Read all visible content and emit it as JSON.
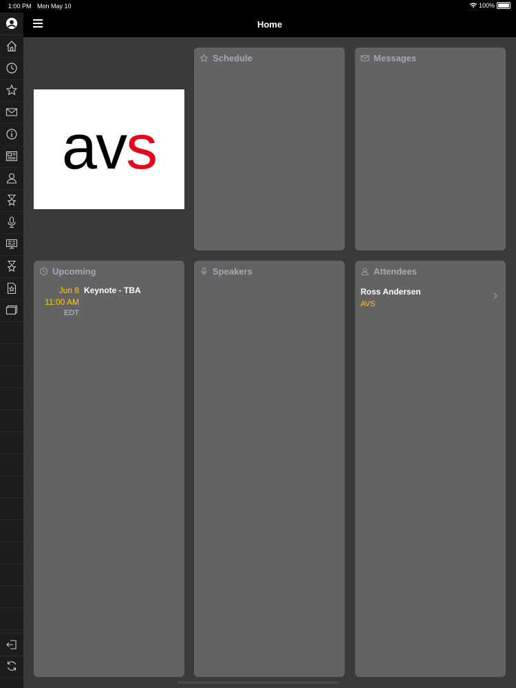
{
  "status_bar": {
    "time": "1:00 PM",
    "date": "Mon May 10",
    "battery": "100%"
  },
  "navbar": {
    "title": "Home",
    "menu_icon": "hamburger-icon"
  },
  "sidebar": {
    "items": [
      {
        "icon": "home-icon"
      },
      {
        "icon": "clock-icon"
      },
      {
        "icon": "star-icon"
      },
      {
        "icon": "envelope-icon"
      },
      {
        "icon": "info-icon"
      },
      {
        "icon": "newspaper-icon"
      },
      {
        "icon": "people-icon"
      },
      {
        "icon": "award-star-icon"
      },
      {
        "icon": "microphone-icon"
      },
      {
        "icon": "presentation-icon"
      },
      {
        "icon": "award-star-icon"
      },
      {
        "icon": "document-star-icon"
      },
      {
        "icon": "windows-icon"
      }
    ],
    "bottom": [
      {
        "icon": "logout-icon"
      },
      {
        "icon": "refresh-icon"
      }
    ]
  },
  "logo": {
    "text_dark": "av",
    "text_red": "s"
  },
  "cards": {
    "schedule": {
      "title": "Schedule",
      "icon": "star-icon"
    },
    "messages": {
      "title": "Messages",
      "icon": "envelope-icon"
    },
    "upcoming": {
      "title": "Upcoming",
      "icon": "clock-icon",
      "events": [
        {
          "day": "Jun 8",
          "time": "11:00 AM",
          "tz": "EDT",
          "name": "Keynote - TBA"
        }
      ]
    },
    "speakers": {
      "title": "Speakers",
      "icon": "microphone-icon"
    },
    "attendees": {
      "title": "Attendees",
      "icon": "people-icon",
      "people": [
        {
          "name": "Ross Andersen",
          "org": "AVS"
        }
      ]
    }
  },
  "colors": {
    "accent": "#ffcc00",
    "logo_red": "#e4061a",
    "card_bg": "#636366",
    "background": "#3a3a3c"
  }
}
